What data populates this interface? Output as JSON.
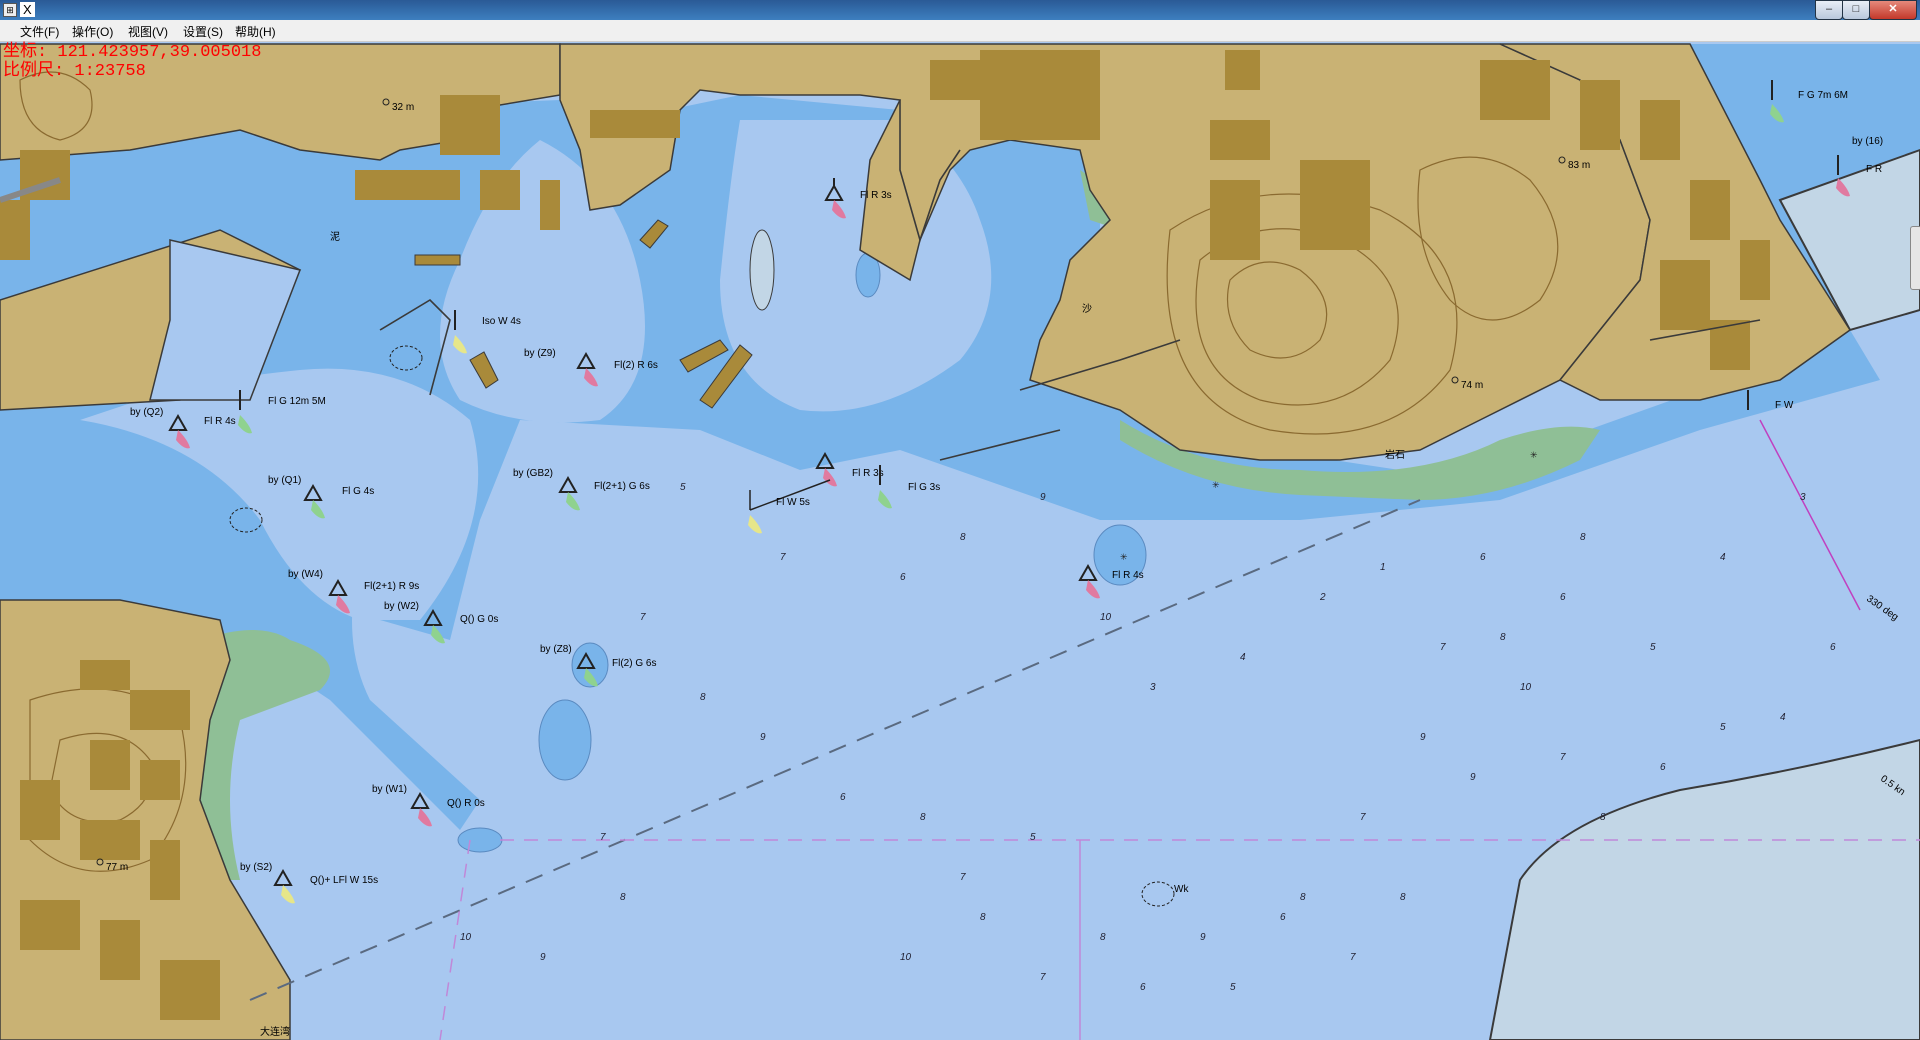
{
  "window": {
    "title": "X",
    "controls": {
      "minimize": "–",
      "maximize": "□",
      "close": "✕"
    }
  },
  "menu": [
    "文件(F)",
    "操作(O)",
    "视图(V)",
    "设置(S)",
    "帮助(H)"
  ],
  "status": {
    "coords": "坐标: 121.423957,39.005018",
    "scale": "比例尺: 1:23758"
  },
  "colors": {
    "land": "#c9b274",
    "built_up": "#a98a3a",
    "shallow_water": "#79b4ea",
    "deep_water": "#a8c8f0",
    "very_deep_water": "#c2d6e6",
    "intertidal": "#8fbf96",
    "contour": "#8a6a30",
    "coastline": "#3a3a3a"
  },
  "chart": {
    "nav_aids": [
      {
        "label": "Fl R 3s"
      },
      {
        "label": "Fl R 3s"
      },
      {
        "label": "Fl G 3s"
      },
      {
        "label": "Fl W 5s"
      },
      {
        "label": "Fl R 4s"
      },
      {
        "label": "Fl G 4s"
      },
      {
        "label": "Fl(2+1) R 9s"
      },
      {
        "label": "Fl(2+1) G 6s"
      },
      {
        "label": "Fl(2) R 6s"
      },
      {
        "label": "Fl(2) G 6s"
      },
      {
        "label": "Q() R 0s"
      },
      {
        "label": "Q() G 0s"
      },
      {
        "label": "Q()+ LFl W 15s"
      },
      {
        "label": "Iso W 4s"
      },
      {
        "label": "Fl G 12m 5M"
      },
      {
        "label": "Fl R 4s"
      },
      {
        "label": "F G 7m 6M"
      },
      {
        "label": "F W"
      },
      {
        "label": "F R"
      }
    ],
    "buoy_names": [
      "by (Q2)",
      "by (Q1)",
      "by (W4)",
      "by (W2)",
      "by (GB2)",
      "by (Z8)",
      "by (Z9)",
      "by (W1)",
      "by (S2)",
      "by (16)"
    ],
    "heights": [
      "32 m",
      "83 m",
      "74 m",
      "77 m"
    ],
    "notes": [
      "330 deg",
      "0.5 kn",
      "Wk",
      "泥",
      "沙",
      "岩石",
      "大连湾"
    ],
    "soundings": [
      "5",
      "7",
      "6",
      "8",
      "9",
      "10",
      "3",
      "4",
      "2",
      "1",
      "7",
      "8",
      "6",
      "5",
      "4",
      "3",
      "7",
      "8",
      "9",
      "6",
      "8",
      "7",
      "5",
      "8",
      "9",
      "6",
      "7",
      "8",
      "9",
      "10",
      "7",
      "8",
      "6",
      "5",
      "4",
      "6",
      "7",
      "8",
      "9",
      "10",
      "10",
      "8",
      "7",
      "6",
      "5",
      "8",
      "7",
      "9",
      "6",
      "8"
    ]
  }
}
